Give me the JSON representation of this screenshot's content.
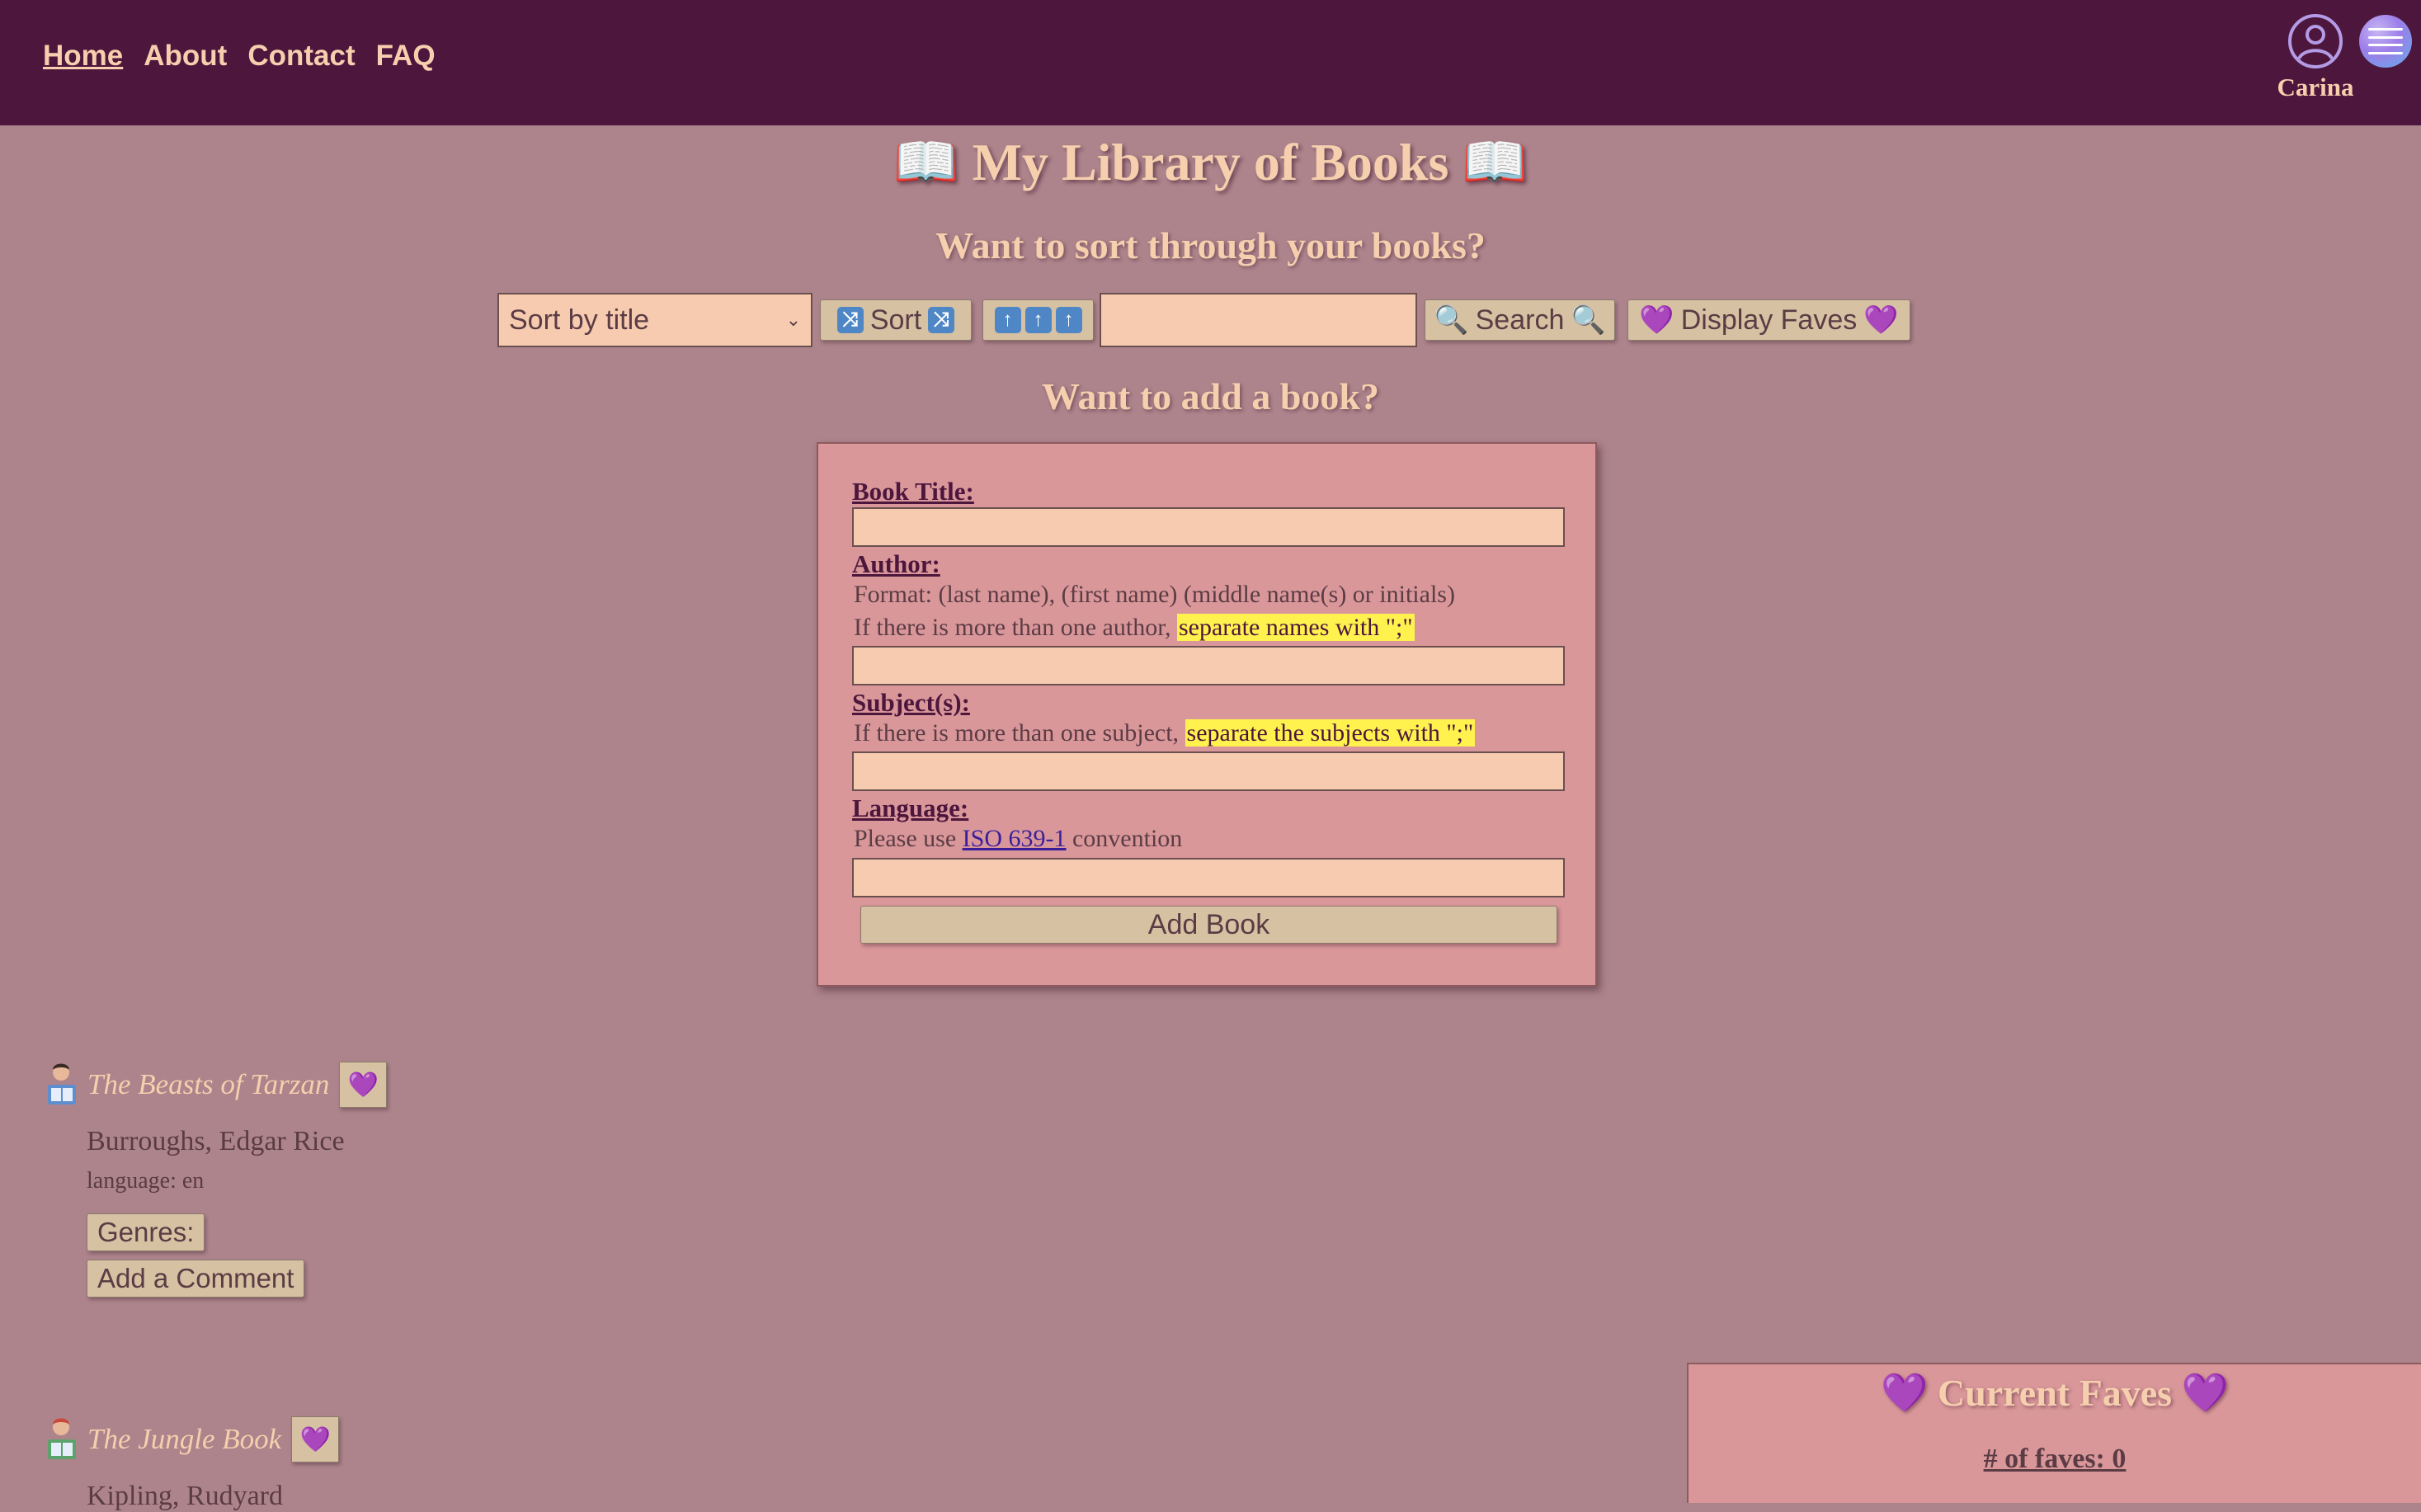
{
  "nav": {
    "items": [
      {
        "label": "Home",
        "active": true
      },
      {
        "label": "About",
        "active": false
      },
      {
        "label": "Contact",
        "active": false
      },
      {
        "label": "FAQ",
        "active": false
      }
    ]
  },
  "user": {
    "name": "Carina",
    "icon": "user-circle-icon"
  },
  "menu": {
    "icon": "hamburger-menu-icon"
  },
  "page": {
    "title": "📖 My Library of Books 📖",
    "sort_heading": "Want to sort through your books?",
    "add_heading": "Want to add a book?"
  },
  "toolbar": {
    "sort_select_value": "Sort by title",
    "sort_button_label": "Sort",
    "sort_button_glyph": "🔀",
    "direction_glyph": "⬆",
    "search_value": "",
    "search_label": "Search",
    "search_glyph": "🔍",
    "display_faves_label": "Display Faves",
    "heart_glyph": "💜"
  },
  "form": {
    "title_label": "Book Title:",
    "author_label": "Author:",
    "author_format_note": "Format: (last name), (first name) (middle name(s) or initials)",
    "author_multi_note": "If there is more than one author, ",
    "author_multi_highlight": "separate names with \";\"",
    "subject_label": "Subject(s):",
    "subject_multi_note": "If there is more than one subject, ",
    "subject_multi_highlight": "separate the subjects with \";\"",
    "language_label": "Language:",
    "language_note_prefix": "Please use ",
    "language_link": "ISO 639-1",
    "language_note_suffix": " convention",
    "submit_label": "Add Book"
  },
  "books": [
    {
      "title": "The Beasts of Tarzan",
      "author": "Burroughs, Edgar Rice",
      "language": "language: en",
      "genres_label": "Genres:",
      "comment_label": "Add a Comment",
      "icon": "person-reading-icon",
      "fave_glyph": "💜"
    },
    {
      "title": "The Jungle Book",
      "author": "Kipling, Rudyard",
      "icon": "person-reading-icon",
      "fave_glyph": "💜"
    }
  ],
  "faves_panel": {
    "title": "💜 Current Faves 💜",
    "count_label": "# of faves: 0"
  },
  "colors": {
    "header_bg": "#4d163c",
    "page_bg": "#ad848c",
    "accent_text": "#f6cfae",
    "panel_bg": "#d9979a",
    "button_bg": "#d6c1a3",
    "input_bg": "#f6cbb0",
    "highlight": "#fff24e"
  }
}
